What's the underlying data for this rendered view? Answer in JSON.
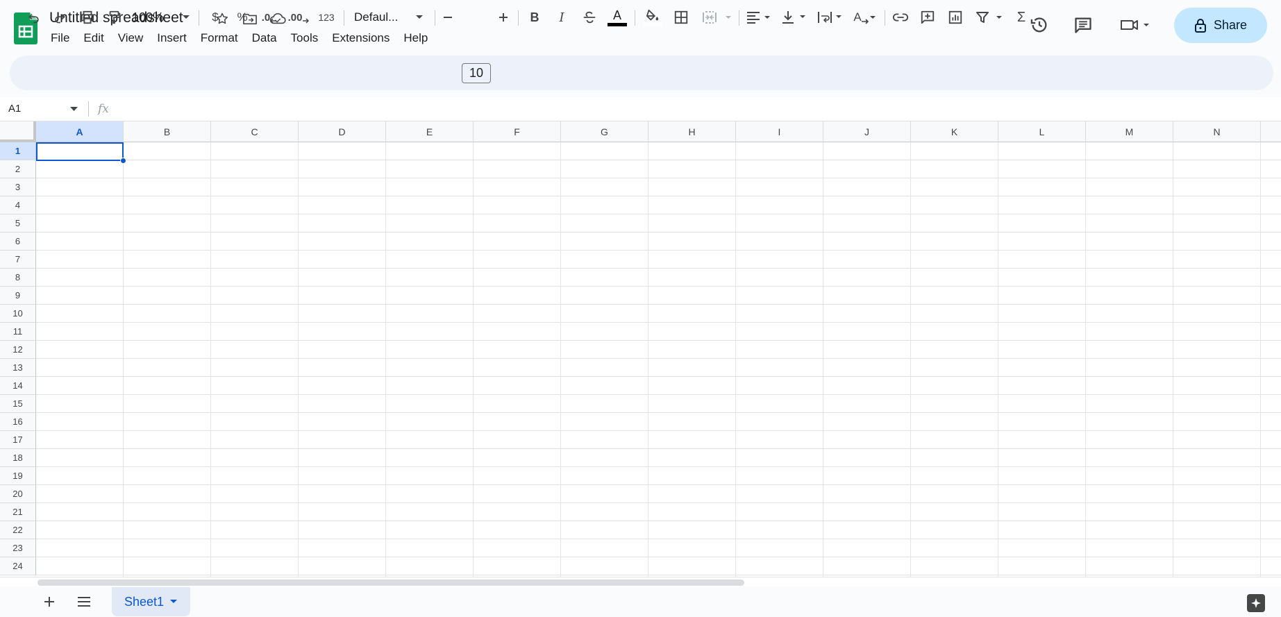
{
  "app": {
    "title": "Untitled spreadsheet",
    "brand_color": "#0F9D58",
    "accent": "#0b57d0"
  },
  "menu": [
    "File",
    "Edit",
    "View",
    "Insert",
    "Format",
    "Data",
    "Tools",
    "Extensions",
    "Help"
  ],
  "header_actions": {
    "share_label": "Share",
    "icons": [
      "history-icon",
      "comments-icon",
      "meet-icon"
    ]
  },
  "toolbar": {
    "zoom": "100%",
    "currency": "$",
    "percent": "%",
    "decrease_decimal": ".0",
    "increase_decimal": ".00",
    "more_formats": "123",
    "font": "Defaul...",
    "font_size": "10",
    "bold": "B",
    "italic": "I",
    "text_color_letter": "A",
    "rotate_letter": "A",
    "sum": "Σ"
  },
  "formula_bar": {
    "name_box": "A1",
    "fx": "fx"
  },
  "grid": {
    "columns": [
      "A",
      "B",
      "C",
      "D",
      "E",
      "F",
      "G",
      "H",
      "I",
      "J",
      "K",
      "L",
      "M",
      "N"
    ],
    "rows": [
      "1",
      "2",
      "3",
      "4",
      "5",
      "6",
      "7",
      "8",
      "9",
      "10",
      "11",
      "12",
      "13",
      "14",
      "15",
      "16",
      "17",
      "18",
      "19",
      "20",
      "21",
      "22",
      "23",
      "24"
    ],
    "selected_cell": "A1"
  },
  "sheets": {
    "tabs": [
      "Sheet1"
    ],
    "active": "Sheet1"
  }
}
